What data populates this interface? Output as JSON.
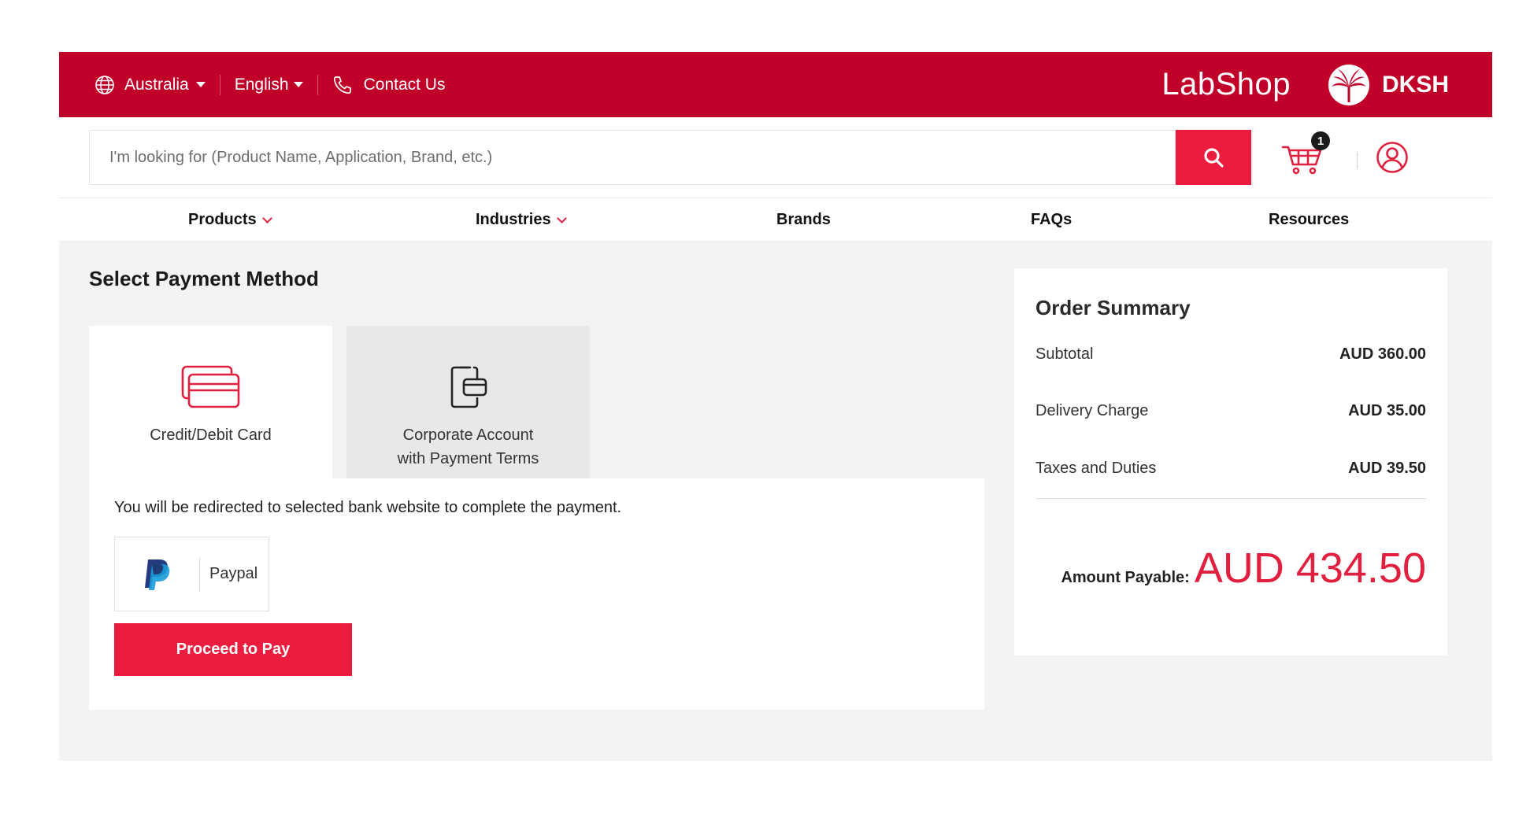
{
  "topbar": {
    "country": "Australia",
    "language": "English",
    "contact": "Contact Us",
    "app_name": "LabShop",
    "brand": "DKSH",
    "bg_color": "#c1002a"
  },
  "search": {
    "placeholder": "I'm looking for (Product Name, Application, Brand, etc.)",
    "button_icon": "search-icon"
  },
  "cart": {
    "count": "1",
    "icon": "cart-icon"
  },
  "account": {
    "icon": "user-icon"
  },
  "nav": {
    "items": [
      {
        "label": "Products"
      },
      {
        "label": "Industries"
      },
      {
        "label": "Brands"
      },
      {
        "label": "FAQs"
      },
      {
        "label": "Resources"
      }
    ]
  },
  "payment": {
    "title": "Select Payment Method",
    "tabs": [
      {
        "label": "Credit/Debit Card",
        "icon": "credit-card-icon",
        "selected": true
      },
      {
        "label": "Corporate Account\nwith Payment Terms",
        "icon": "corporate-account-icon",
        "selected": false
      }
    ],
    "note": "You will be redirected to selected bank website to complete the payment.",
    "option_label": "Paypal",
    "proceed_label": "Proceed to Pay",
    "accent_color": "#ec1c3e"
  },
  "summary": {
    "title": "Order Summary",
    "rows": [
      {
        "label": "Subtotal",
        "value": "AUD 360.00"
      },
      {
        "label": "Delivery Charge",
        "value": "AUD 35.00"
      },
      {
        "label": "Taxes and Duties",
        "value": "AUD 39.50"
      }
    ],
    "total_label": "Amount Payable:",
    "total_value": "AUD 434.50"
  }
}
